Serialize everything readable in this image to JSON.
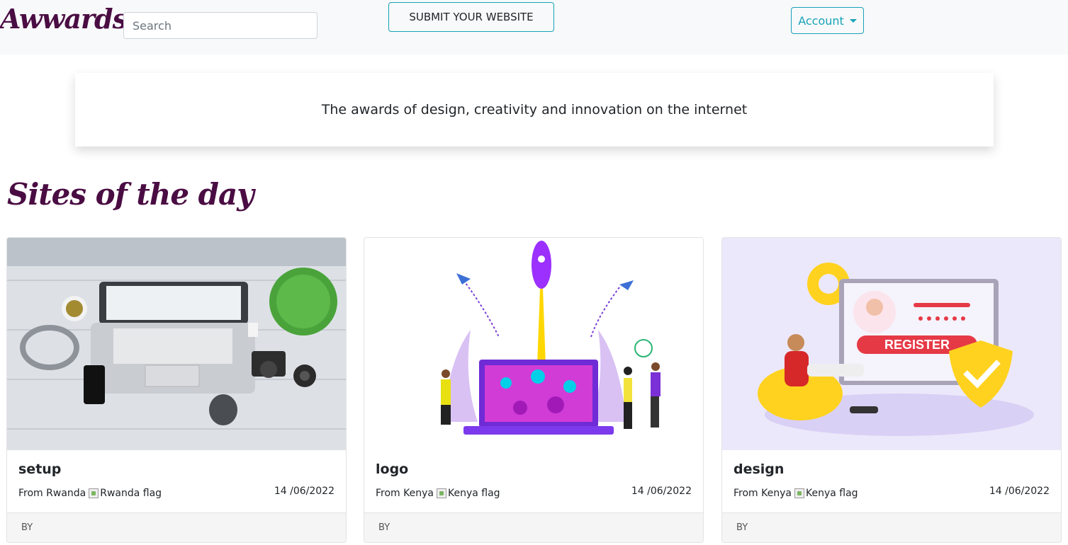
{
  "navbar": {
    "brand": "Awwards",
    "search_placeholder": "Search",
    "submit_label": "SUBMIT YOUR WEBSITE",
    "account_label": "Account"
  },
  "banner": {
    "text": "The awards of design, creativity and innovation on the internet"
  },
  "section": {
    "title": "Sites of the day"
  },
  "cards": [
    {
      "title": "setup",
      "from": "From Rwanda",
      "flag_alt": "Rwanda flag",
      "date": "14 /06/2022",
      "footer": "BY"
    },
    {
      "title": "logo",
      "from": "From Kenya",
      "flag_alt": "Kenya flag",
      "date": "14 /06/2022",
      "footer": "BY"
    },
    {
      "title": "design",
      "from": "From Kenya",
      "flag_alt": "Kenya flag",
      "date": "14 /06/2022",
      "footer": "BY"
    }
  ],
  "images": [
    {
      "description_icon": "desk-setup-image"
    },
    {
      "description_icon": "rocket-launch-image",
      "colors": {
        "purple": "#8a2be2",
        "magenta": "#c71585",
        "yellow": "#ffd700"
      }
    },
    {
      "description_icon": "register-illustration-image",
      "register_text": "REGISTER",
      "colors": {
        "bg": "#ece8fb",
        "red": "#e63946",
        "yellow": "#ffd21f"
      }
    }
  ],
  "colors": {
    "brand": "#4a0d43",
    "accent": "#17a2b8"
  }
}
